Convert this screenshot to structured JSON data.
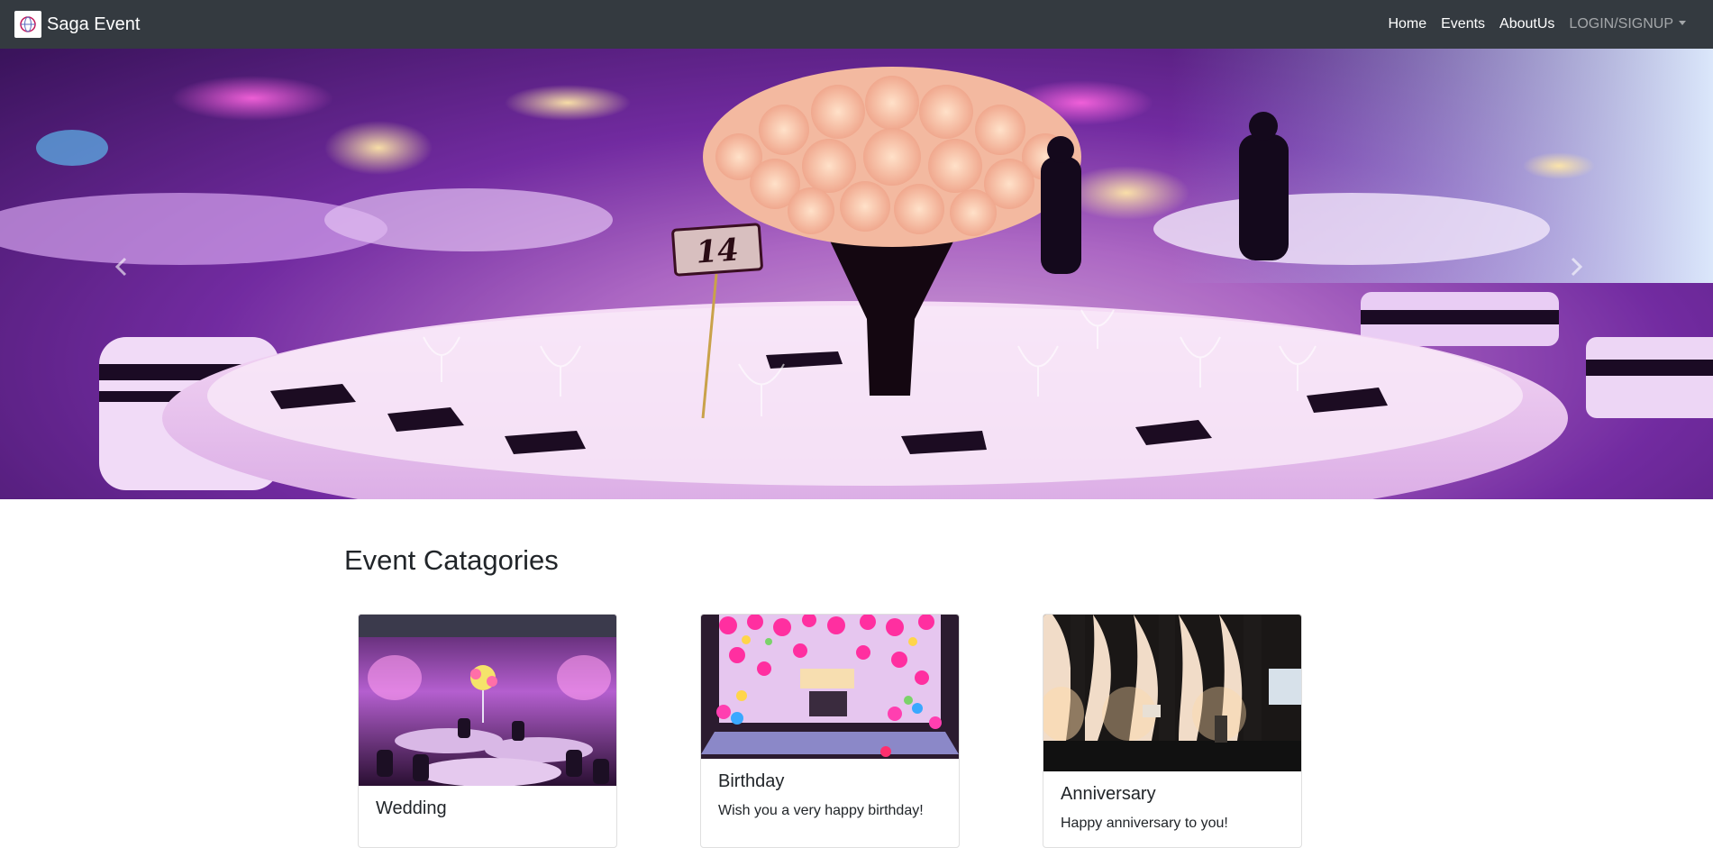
{
  "navbar": {
    "brand": "Saga Event",
    "links": [
      {
        "label": "Home"
      },
      {
        "label": "Events"
      },
      {
        "label": "AboutUs"
      },
      {
        "label": "LOGIN/SIGNUP"
      }
    ]
  },
  "hero": {
    "table_number": "14",
    "prev_icon": "chevron-left-icon",
    "next_icon": "chevron-right-icon"
  },
  "section": {
    "title": "Event Catagories"
  },
  "cards": [
    {
      "title": "Wedding",
      "text": ""
    },
    {
      "title": "Birthday",
      "text": "Wish you a very happy birthday!"
    },
    {
      "title": "Anniversary",
      "text": "Happy anniversary to you!"
    }
  ],
  "colors": {
    "navbar_bg": "#343a40",
    "text": "#212529",
    "hero_accent": "#a04fc8"
  }
}
